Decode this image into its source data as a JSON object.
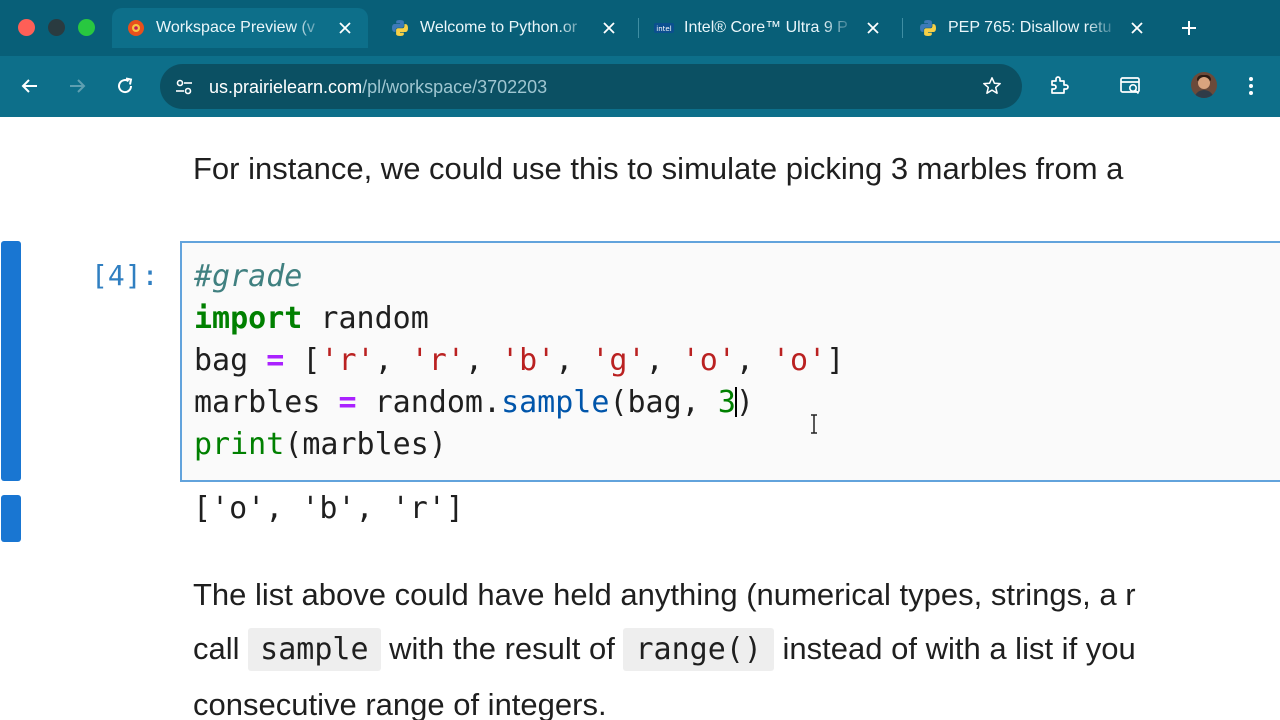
{
  "window": {
    "traffic_lights": [
      "close",
      "minimize",
      "zoom"
    ]
  },
  "tabs": [
    {
      "label": "Workspace Preview (v",
      "active": true,
      "icon": "prairielearn-favicon"
    },
    {
      "label": "Welcome to Python.or",
      "active": false,
      "icon": "python-favicon"
    },
    {
      "label": "Intel® Core™ Ultra 9 P",
      "active": false,
      "icon": "intel-favicon"
    },
    {
      "label": "PEP 765: Disallow retu",
      "active": false,
      "icon": "python-favicon"
    }
  ],
  "toolbar": {
    "url_host": "us.prairielearn.com",
    "url_path": "/pl/workspace/3702203"
  },
  "notebook": {
    "intro_text": "For instance, we could use this to simulate picking 3 marbles from a",
    "cell": {
      "prompt": "[4]:",
      "comment": "#grade",
      "line2_kw": "import",
      "line2_rest": " random",
      "line3": {
        "var": "bag",
        "eq": "=",
        "open": "[",
        "items": [
          "'r'",
          "'r'",
          "'b'",
          "'g'",
          "'o'",
          "'o'"
        ],
        "sep": ", ",
        "close": "]"
      },
      "line4": {
        "var": "marbles",
        "eq": "=",
        "obj": "random.",
        "fn": "sample",
        "args_before_num": "(bag, ",
        "num": "3",
        "close": ")"
      },
      "line5": {
        "fn": "print",
        "args": "(marbles)"
      }
    },
    "output": "['o', 'b', 'r']",
    "para1": "The list above could have held anything (numerical types, strings, a r",
    "para2_a": "call",
    "para2_code1": "sample",
    "para2_b": "with the result of",
    "para2_code2": "range()",
    "para2_c": "instead of with a list if you",
    "para3": "consecutive range of integers."
  },
  "colors": {
    "chrome_tabstrip": "#085f78",
    "chrome_toolbar": "#0d6f8a",
    "cell_accent": "#1976d2",
    "cell_border": "#62a3dc",
    "prompt": "#307fc1"
  }
}
